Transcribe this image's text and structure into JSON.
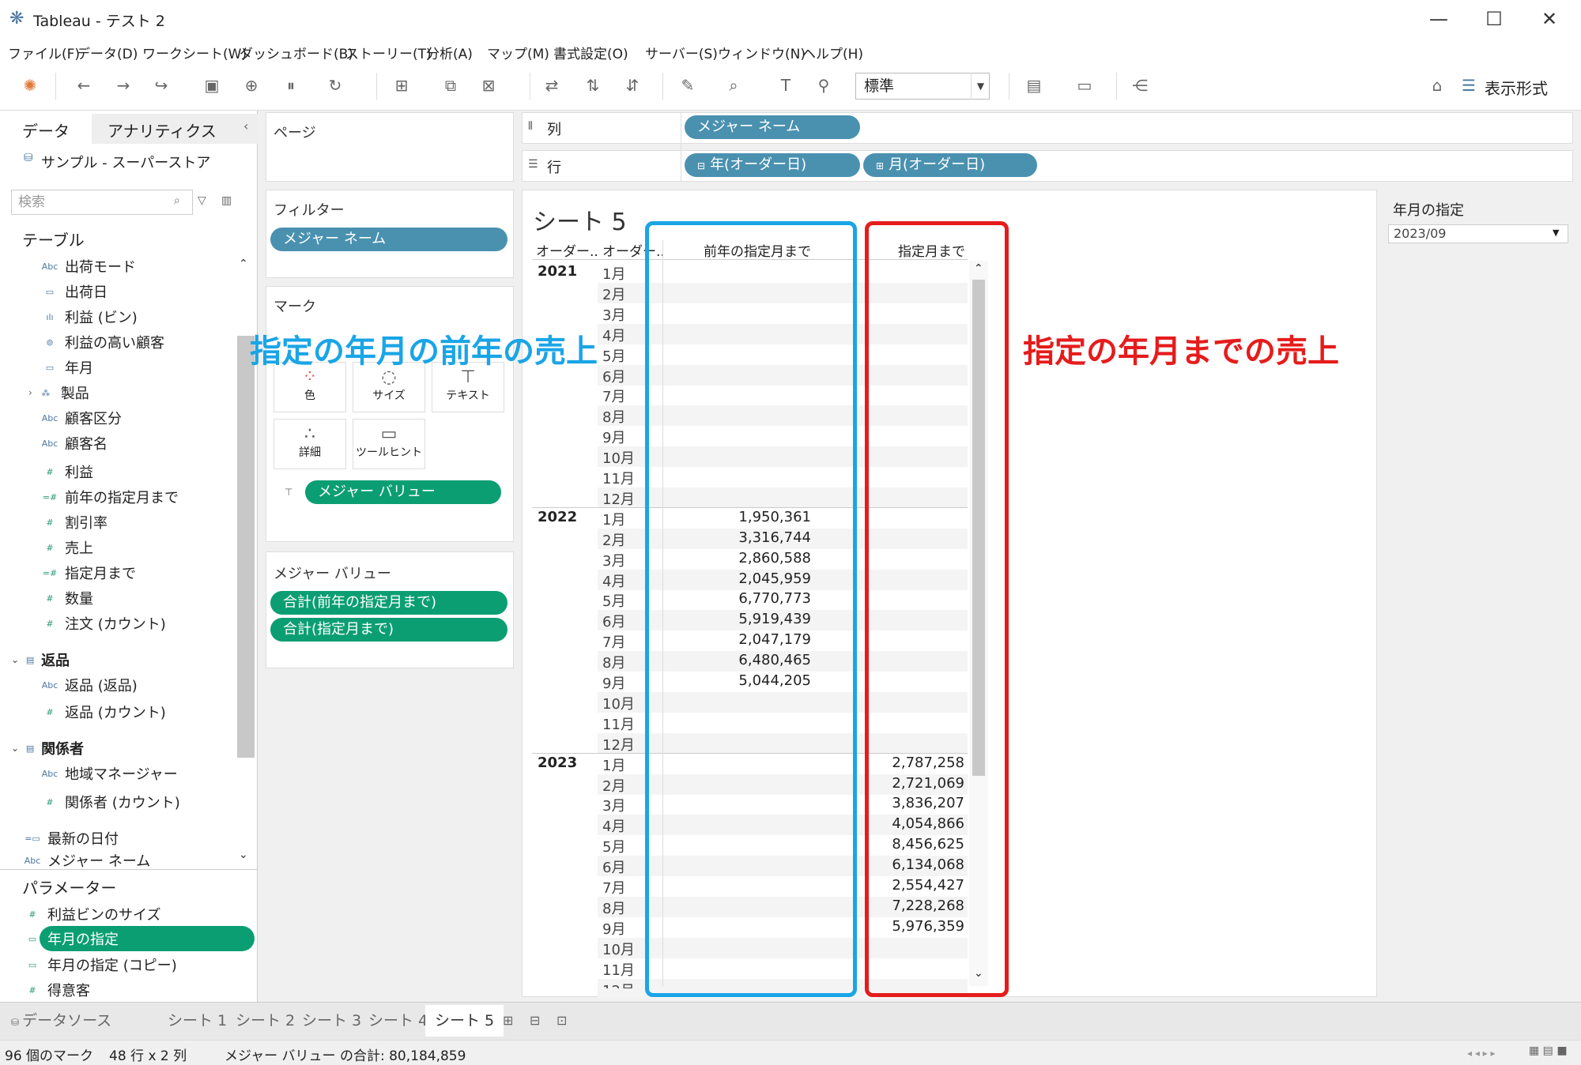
{
  "window": {
    "title": "Tableau - テスト 2"
  },
  "menu": [
    "ファイル(F)",
    "データ(D)",
    "ワークシート(W)",
    "ダッシュボード(B)",
    "ストーリー(T)",
    "分析(A)",
    "マップ(M)",
    "書式設定(O)",
    "サーバー(S)",
    "ウィンドウ(N)",
    "ヘルプ(H)"
  ],
  "toolbar": {
    "fit_value": "標準",
    "show_me": "表示形式"
  },
  "left": {
    "tabs": [
      "データ",
      "アナリティクス"
    ],
    "datasource": "サンプル - スーパーストア",
    "search_placeholder": "検索",
    "tables_header": "テーブル",
    "fields": [
      "出荷モード",
      "出荷日",
      "利益 (ビン)",
      "利益の高い顧客",
      "年月",
      "製品",
      "顧客区分",
      "顧客名",
      "利益",
      "前年の指定月まで",
      "割引率",
      "売上",
      "指定月まで",
      "数量",
      "注文 (カウント)"
    ],
    "group_returns": "返品",
    "returns_fields": [
      "返品 (返品)",
      "返品 (カウント)"
    ],
    "group_people": "関係者",
    "people_fields": [
      "地域マネージャー",
      "関係者 (カウント)"
    ],
    "other_fields": [
      "最新の日付",
      "メジャー ネーム"
    ],
    "params_header": "パラメーター",
    "params": [
      "利益ビンのサイズ",
      "年月の指定",
      "年月の指定 (コピー)",
      "得意客"
    ]
  },
  "middle": {
    "pages": "ページ",
    "filters": "フィルター",
    "filter_pill": "メジャー ネーム",
    "marks": "マーク",
    "mark_buttons": [
      "色",
      "サイズ",
      "テキスト",
      "詳細",
      "ツールヒント"
    ],
    "marks_pill": "メジャー バリュー",
    "measure_values": "メジャー バリュー",
    "mv_pills": [
      "合計(前年の指定月まで)",
      "合計(指定月まで)"
    ]
  },
  "shelves": {
    "columns_label": "列",
    "rows_label": "行",
    "columns_pill": "メジャー ネーム",
    "rows_pills": [
      "年(オーダー日)",
      "月(オーダー日)"
    ]
  },
  "viz": {
    "title": "シート 5",
    "headers": [
      "オーダー..",
      "オーダー..",
      "前年の指定月まで",
      "指定月まで"
    ],
    "years": [
      "2021",
      "2022",
      "2023"
    ],
    "months": [
      "1月",
      "2月",
      "3月",
      "4月",
      "5月",
      "6月",
      "7月",
      "8月",
      "9月",
      "10月",
      "11月",
      "12月"
    ],
    "prev_2022": [
      "1,950,361",
      "3,316,744",
      "2,860,588",
      "2,045,959",
      "6,770,773",
      "5,919,439",
      "2,047,179",
      "6,480,465",
      "5,044,205"
    ],
    "cur_2023": [
      "2,787,258",
      "2,721,069",
      "3,836,207",
      "4,054,866",
      "8,456,625",
      "6,134,068",
      "2,554,427",
      "7,228,268",
      "5,976,359"
    ]
  },
  "annotations": {
    "blue": "指定の年月の前年の売上",
    "red": "指定の年月までの売上",
    "blue_color": "#1aa5e6",
    "red_color": "#e51c1c"
  },
  "param_card": {
    "title": "年月の指定",
    "value": "2023/09"
  },
  "tabs": [
    "データソース",
    "シート 1",
    "シート 2",
    "シート 3",
    "シート 4",
    "シート 5"
  ],
  "status": {
    "marks": "96 個のマーク",
    "dims": "48 行 x 2 列",
    "sum": "メジャー バリュー の合計: 80,184,859"
  }
}
